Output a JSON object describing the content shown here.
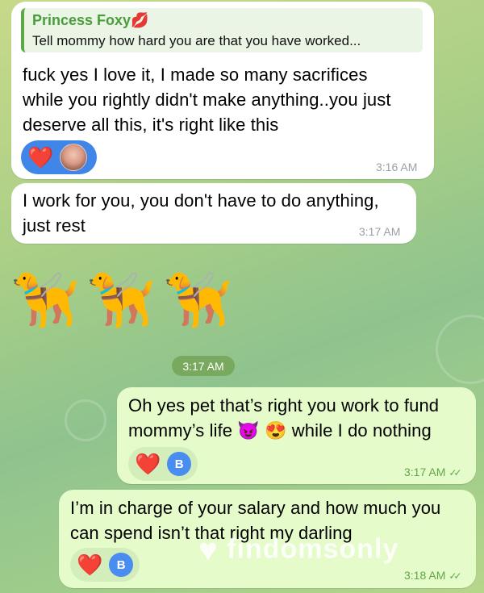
{
  "messages": {
    "msg1": {
      "reply_name": "Princess Foxy",
      "reply_name_emoji": "💋",
      "reply_text": "Tell mommy how hard you are that you have worked...",
      "lines": [
        "fuck yes I love it, I made so many sacrifices",
        "while you rightly didn't make anything..you just",
        "deserve all this, it's right like this"
      ],
      "reaction": "❤️",
      "time": "3:16 AM"
    },
    "msg2": {
      "lines": [
        "I work for you, you don't have to do anything,",
        "just rest"
      ],
      "time": "3:17 AM"
    },
    "dogs": {
      "emoji": "🦮",
      "time": "3:17 AM"
    },
    "msg3": {
      "line1": "Oh yes pet that’s right you work to fund",
      "line2_start": "mommy’s life",
      "line2_emoji1": "😈",
      "line2_emoji2": "😍",
      "line2_end": "while I do nothing",
      "reaction": "❤️",
      "reaction_avatar": "B",
      "time": "3:17 AM"
    },
    "msg4": {
      "lines": [
        "I’m in charge of your salary and how much you",
        "can spend isn’t that right my darling"
      ],
      "reaction": "❤️",
      "reaction_avatar": "B",
      "time": "3:18 AM"
    }
  },
  "watermark": "findomsonly",
  "icons": {
    "read_receipt": "double-check-icon"
  },
  "colors": {
    "outgoing_bubble": "#e5fbc9",
    "incoming_bubble": "#ffffff",
    "reaction_blue": "#3f86e8",
    "sender_green": "#4a9d3b"
  }
}
